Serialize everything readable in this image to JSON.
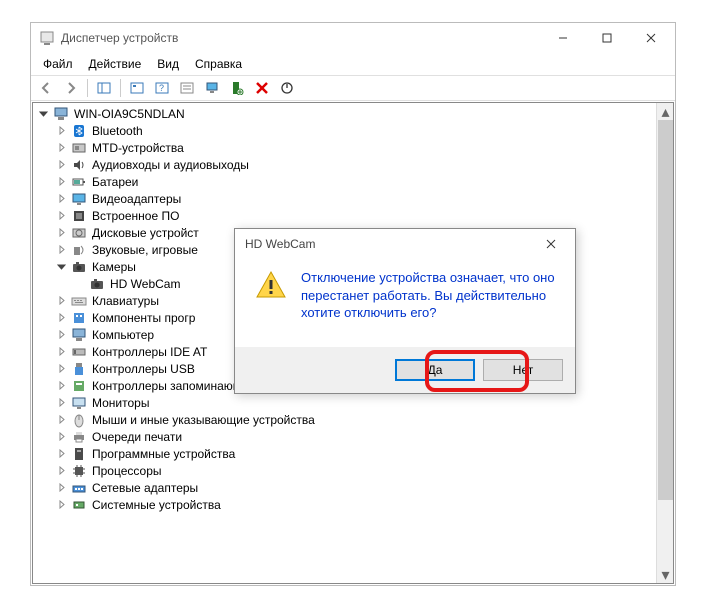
{
  "window": {
    "title": "Диспетчер устройств",
    "minimize": "—",
    "maximize": "☐",
    "close": "✕"
  },
  "menu": {
    "file": "Файл",
    "action": "Действие",
    "view": "Вид",
    "help": "Справка"
  },
  "tree": {
    "root": "WIN-OIA9C5NDLAN",
    "nodes": [
      {
        "label": "Bluetooth",
        "icon": "bluetooth"
      },
      {
        "label": "MTD-устройства",
        "icon": "mtd"
      },
      {
        "label": "Аудиовходы и аудиовыходы",
        "icon": "audio"
      },
      {
        "label": "Батареи",
        "icon": "battery"
      },
      {
        "label": "Видеоадаптеры",
        "icon": "display"
      },
      {
        "label": "Встроенное ПО",
        "icon": "firmware"
      },
      {
        "label": "Дисковые устройст",
        "icon": "disk"
      },
      {
        "label": "Звуковые, игровые",
        "icon": "sound"
      },
      {
        "label": "Камеры",
        "icon": "camera",
        "expanded": true,
        "child": "HD WebCam"
      },
      {
        "label": "Клавиатуры",
        "icon": "keyboard"
      },
      {
        "label": "Компоненты прогр",
        "icon": "software"
      },
      {
        "label": "Компьютер",
        "icon": "computer"
      },
      {
        "label": "Контроллеры IDE AT",
        "icon": "ide"
      },
      {
        "label": "Контроллеры USB",
        "icon": "usb"
      },
      {
        "label": "Контроллеры запоминающих устройств",
        "icon": "storage"
      },
      {
        "label": "Мониторы",
        "icon": "monitor"
      },
      {
        "label": "Мыши и иные указывающие устройства",
        "icon": "mouse"
      },
      {
        "label": "Очереди печати",
        "icon": "print"
      },
      {
        "label": "Программные устройства",
        "icon": "software2"
      },
      {
        "label": "Процессоры",
        "icon": "cpu"
      },
      {
        "label": "Сетевые адаптеры",
        "icon": "network"
      },
      {
        "label": "Системные устройства",
        "icon": "system"
      }
    ]
  },
  "dialog": {
    "title": "HD WebCam",
    "message": "Отключение устройства означает, что оно перестанет работать. Вы действительно хотите отключить его?",
    "yes": "Да",
    "no": "Нет"
  }
}
